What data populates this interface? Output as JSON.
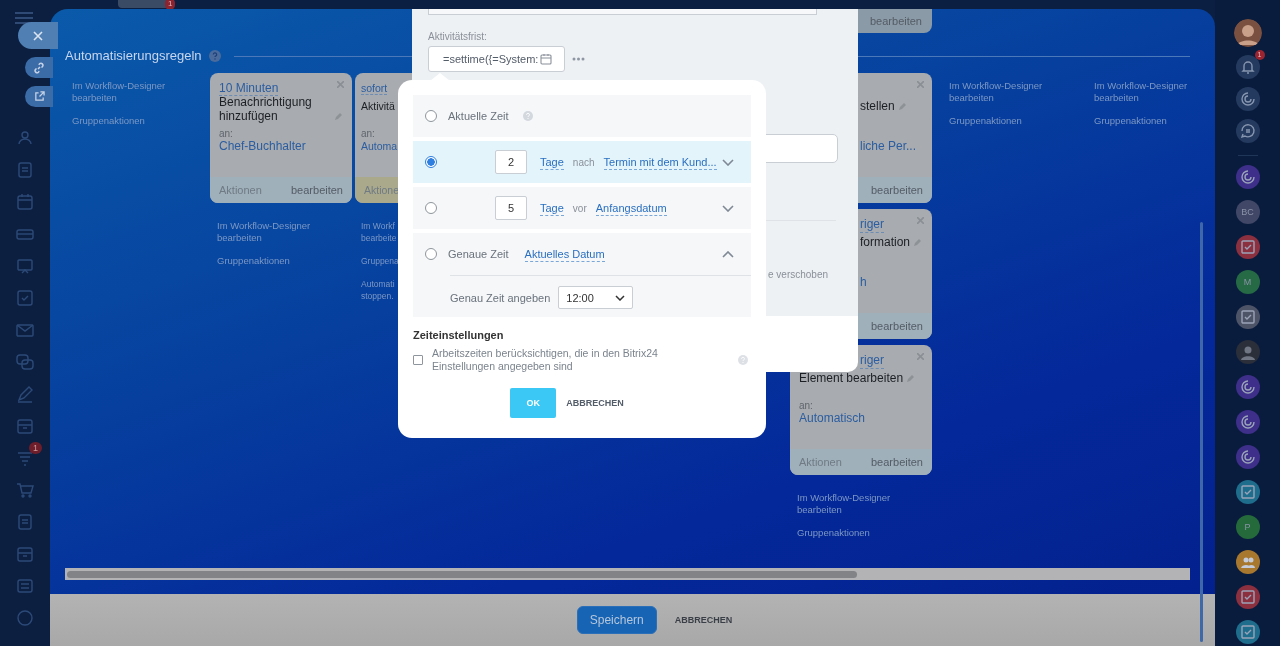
{
  "top_badge": "1",
  "left_rail": {
    "badge": "1"
  },
  "right_rail": {
    "top": [
      {
        "kind": "photo"
      },
      {
        "kind": "bell",
        "badge": "1"
      },
      {
        "kind": "spiral"
      },
      {
        "kind": "chat"
      }
    ],
    "apps": [
      {
        "kind": "spiral",
        "color": "#3d2f8a"
      },
      {
        "kind": "initials",
        "text": "BC",
        "color": "#414766"
      },
      {
        "kind": "task",
        "color": "#8c2f3f"
      },
      {
        "kind": "initials",
        "text": "M",
        "color": "#256a45"
      },
      {
        "kind": "task",
        "color": "#4e5468"
      },
      {
        "kind": "photo",
        "color": "#2b2f3a"
      },
      {
        "kind": "spiral",
        "color": "#3d2f8a"
      },
      {
        "kind": "spiral",
        "color": "#3d2f8a"
      },
      {
        "kind": "spiral",
        "color": "#3d2f8a"
      },
      {
        "kind": "task",
        "color": "#1f6d8c"
      },
      {
        "kind": "initials",
        "text": "P",
        "color": "#256a3a"
      },
      {
        "kind": "people",
        "color": "#a8782e"
      },
      {
        "kind": "task",
        "color": "#8c2f3f"
      },
      {
        "kind": "task",
        "color": "#1f6d8c"
      }
    ]
  },
  "section": {
    "title": "Automatisierungsregeln"
  },
  "columns": [
    {
      "links": [
        "Im Workflow-Designer bearbeiten",
        "Gruppenaktionen"
      ]
    },
    {
      "cards": [
        {
          "color": "#9fb0bb",
          "lines": [
            {
              "kind": "delay",
              "text": "10 Minuten",
              "covered": false
            },
            {
              "kind": "title",
              "text": "Benachrichtigung hinzufügen",
              "covered": false,
              "editable": true
            },
            {
              "kind": "label",
              "text": "an:",
              "covered": false
            },
            {
              "kind": "recipient",
              "text": "Chef-Buchhalter",
              "covered": false
            }
          ],
          "footer_left": "Aktionen",
          "footer_right": "bearbeiten"
        }
      ],
      "links": [
        "Im Workflow-Designer bearbeiten",
        "Gruppenaktionen"
      ]
    },
    {
      "cards": [
        {
          "color": "#aaa98b",
          "lines": [
            {
              "kind": "delay",
              "text": "sofort",
              "covered": false
            },
            {
              "kind": "title",
              "text": "Aktivitä",
              "covered": false,
              "editable": false
            },
            {
              "kind": "label",
              "text": "an:",
              "covered": false
            },
            {
              "kind": "recipient",
              "text": "Automa",
              "covered": false
            }
          ],
          "footer_left": "Aktione"
        }
      ],
      "links": [
        "Im Workf bearbeite",
        "Gruppena",
        "Automati stoppen."
      ]
    },
    {
      "stub": "bearbeiten",
      "cards": [
        {
          "color": "#9fb0bb",
          "lines": [
            {
              "kind": "title",
              "text": "stellen",
              "covered": true,
              "editable": true
            },
            {
              "kind": "recipient",
              "text": "liche Per...",
              "covered": true
            }
          ],
          "footer_right": "bearbeiten"
        },
        {
          "color": "#9fb0bb",
          "lines": [
            {
              "kind": "delay",
              "text": "riger",
              "covered": true
            },
            {
              "kind": "title",
              "text": "formation",
              "covered": true,
              "editable": true
            },
            {
              "kind": "recipient",
              "text": "h",
              "covered": true
            }
          ],
          "footer_right": "bearbeiten"
        },
        {
          "color": "#9fb0bb",
          "lines": [
            {
              "kind": "delay",
              "text": "riger",
              "covered": true
            },
            {
              "kind": "title",
              "text": "Element bearbeiten",
              "covered": false,
              "editable": true
            },
            {
              "kind": "label",
              "text": "an:",
              "covered": false
            },
            {
              "kind": "recipient",
              "text": "Automatisch",
              "covered": false
            }
          ],
          "footer_left": "Aktionen",
          "footer_right": "bearbeiten"
        }
      ],
      "links": [
        "Im Workflow-Designer bearbeiten",
        "Gruppenaktionen"
      ]
    },
    {
      "links": [
        "Im Workflow-Designer bearbeiten",
        "Gruppenaktionen"
      ]
    },
    {
      "links": [
        "Im Workflow-Designer bearbeiten",
        "Gruppenaktionen"
      ]
    }
  ],
  "settings_panel": {
    "deadline_label": "Aktivitätsfrist:",
    "deadline_value": "=settime({=System:",
    "moved_text": "e verschoben"
  },
  "time_popup": {
    "options": [
      {
        "kind": "current",
        "selected": false,
        "label": "Aktuelle Zeit"
      },
      {
        "kind": "offset",
        "selected": true,
        "amount": "2",
        "unit": "Tage",
        "relation": "nach",
        "reference": "Termin mit dem Kund..."
      },
      {
        "kind": "offset",
        "selected": false,
        "amount": "5",
        "unit": "Tage",
        "relation": "vor",
        "reference": "Anfangsdatum"
      },
      {
        "kind": "exact",
        "selected": false,
        "expanded": true,
        "label": "Genaue Zeit",
        "reference": "Aktuelles Datum",
        "time_label": "Genau Zeit angeben",
        "time": "12:00"
      }
    ],
    "settings_title": "Zeiteinstellungen",
    "work_hours": {
      "checked": false,
      "label": "Arbeitszeiten berücksichtigen, die in den Bitrix24 Einstellungen angegeben sind"
    },
    "ok": "OK",
    "cancel": "ABBRECHEN"
  },
  "footer": {
    "save": "Speichern",
    "cancel": "ABBRECHEN"
  }
}
